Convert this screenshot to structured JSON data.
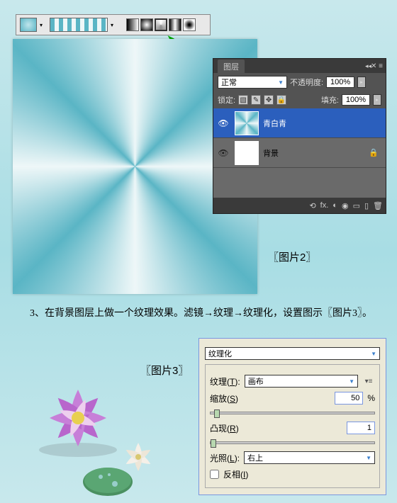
{
  "toolbar": {
    "gradient_preview": "cyan-white-cyan"
  },
  "layers_panel": {
    "title": "图层",
    "blend_mode": "正常",
    "opacity_label": "不透明度:",
    "opacity_value": "100%",
    "lock_label": "锁定:",
    "fill_label": "填充:",
    "fill_value": "100%",
    "layers": [
      {
        "name": "青白青",
        "selected": true
      },
      {
        "name": "背景",
        "selected": false,
        "locked": true
      }
    ],
    "footer_icons": {
      "link": "⟲",
      "fx": "fx.",
      "mask": "◐",
      "adjust": "◉",
      "folder": "▭",
      "new": "▯",
      "trash": "🗑"
    }
  },
  "captions": {
    "fig2": "〖图片2〗",
    "fig3": "〖图片3〗"
  },
  "instruction": "　　3、在背景图层上做一个纹理效果。滤镜→纹理→纹理化，设置图示〖图片3〗。",
  "texturize": {
    "title": "纹理化",
    "texture_label": "纹理",
    "texture_key": "T",
    "texture_value": "画布",
    "scale_label": "缩放",
    "scale_key": "S",
    "scale_value": "50",
    "scale_unit": "%",
    "relief_label": "凸现",
    "relief_key": "R",
    "relief_value": "1",
    "light_label": "光照",
    "light_key": "L",
    "light_value": "右上",
    "invert_label": "反相",
    "invert_key": "I"
  },
  "chart_data": null
}
